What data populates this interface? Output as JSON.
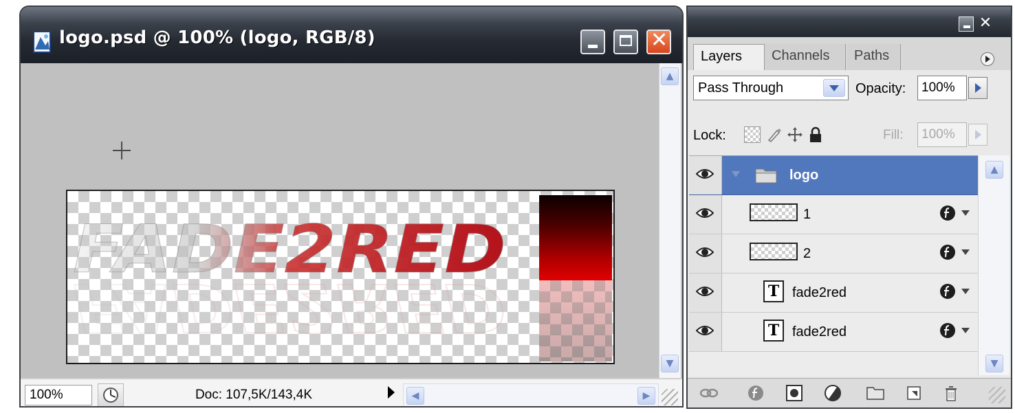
{
  "document": {
    "title": "logo.psd @ 100% (logo, RGB/8)",
    "zoom": "100%",
    "doc_size": "Doc: 107,5K/143,4K",
    "canvas_text": "FADE2RED"
  },
  "window_buttons": {
    "minimize": "minimize-icon",
    "maximize": "maximize-icon",
    "close": "close-icon"
  },
  "panel": {
    "tabs": [
      {
        "label": "Layers",
        "active": true
      },
      {
        "label": "Channels",
        "active": false
      },
      {
        "label": "Paths",
        "active": false
      }
    ],
    "blend_mode": "Pass Through",
    "opacity_label": "Opacity:",
    "opacity_value": "100%",
    "lock_label": "Lock:",
    "fill_label": "Fill:",
    "fill_value": "100%",
    "layers": [
      {
        "name": "logo",
        "type": "group",
        "selected": true
      },
      {
        "name": "1",
        "type": "raster",
        "effects": true
      },
      {
        "name": "2",
        "type": "raster",
        "effects": true
      },
      {
        "name": "fade2red",
        "type": "text",
        "effects": true
      },
      {
        "name": "fade2red",
        "type": "text",
        "effects": true
      }
    ],
    "text_layer_thumb": "T"
  },
  "colors": {
    "title_bar": "#23272f",
    "close_button": "#d8451e",
    "selection": "#5177bd",
    "logo_red": "#b3121a"
  }
}
